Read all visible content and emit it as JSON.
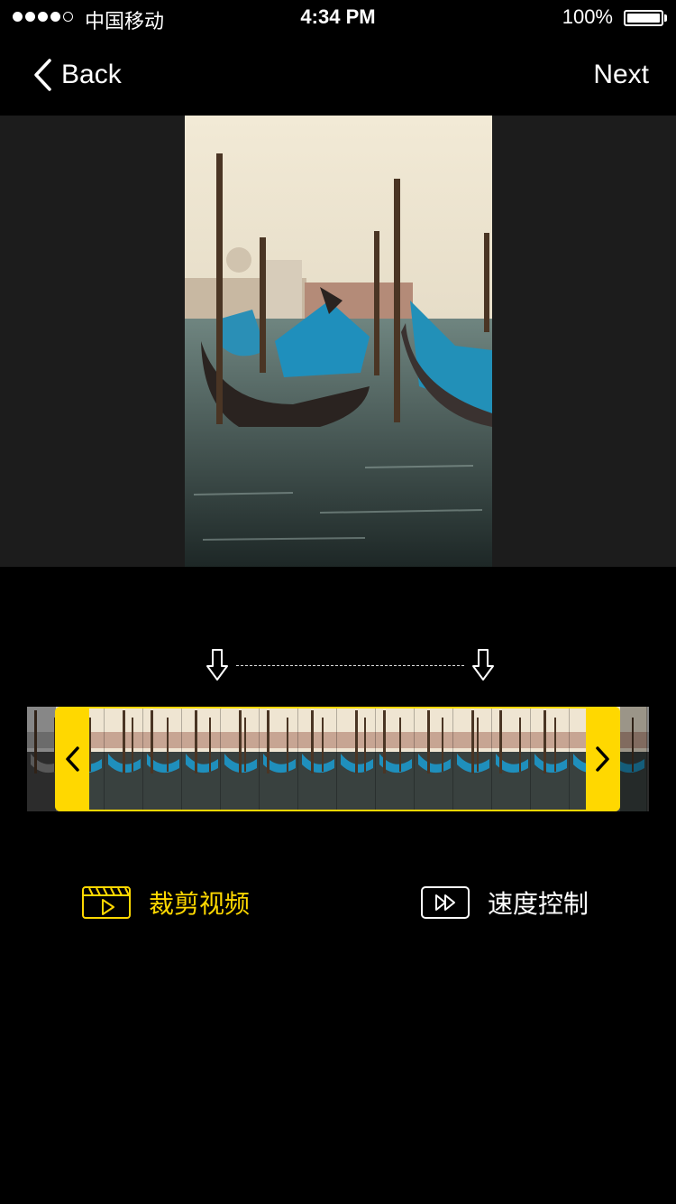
{
  "status_bar": {
    "carrier": "中国移动",
    "time": "4:34 PM",
    "battery_percent": "100%",
    "signal_bars_filled": 4,
    "signal_bars_total": 5
  },
  "nav": {
    "back_label": "Back",
    "next_label": "Next"
  },
  "tools": {
    "trim_label": "裁剪视频",
    "speed_label": "速度控制"
  },
  "colors": {
    "accent": "#ffd800",
    "background": "#000000",
    "preview_background": "#1c1c1c",
    "inactive_text": "#ffffff"
  },
  "icons": {
    "back": "chevron-left-icon",
    "trim_start_marker": "arrow-down-outline-icon",
    "trim_end_marker": "arrow-down-outline-icon",
    "handle_left": "chevron-left-icon",
    "handle_right": "chevron-right-icon",
    "trim_tool": "clapperboard-play-icon",
    "speed_tool": "fast-forward-icon"
  }
}
